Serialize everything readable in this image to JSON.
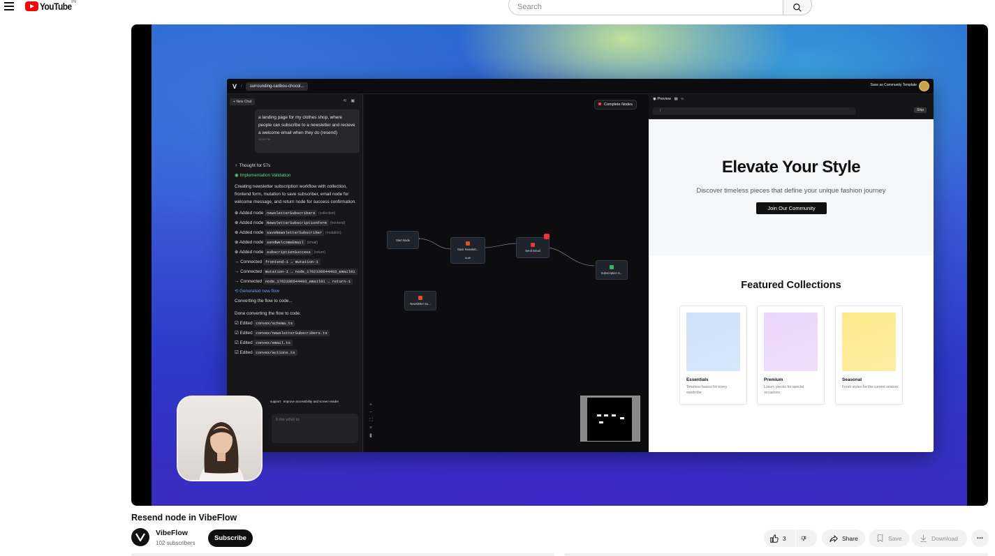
{
  "header": {
    "logo_text": "YouTube",
    "country_code": "IN",
    "search_placeholder": "Search"
  },
  "video": {
    "app": {
      "logo": "V",
      "project_name": "surrounding-caribou-chocol...",
      "save_template_label": "Save as Community Template",
      "new_chat_label": "New Chat",
      "prompt_text": "a landing page for my clothes shop, where people can subscribe to a newsletter and recieve a welcome email when they do (resend)",
      "prompt_time": "03:58 PM",
      "thought": "Thought for 57s",
      "validation": "Implementation Validation",
      "summary": "Creating newsletter subscription workflow with collection, frontend form, mutation to save subscriber, email node for welcome message, and return node for success confirmation.",
      "log_rows": [
        {
          "action": "Added node",
          "code": "newsletterSubscribers",
          "tag": "(collection)"
        },
        {
          "action": "Added node",
          "code": "NewsletterSubscriptionForm",
          "tag": "(frontend)"
        },
        {
          "action": "Added node",
          "code": "saveNewsletterSubscriber",
          "tag": "(mutation)"
        },
        {
          "action": "Added node",
          "code": "sendWelcomeEmail",
          "tag": "(email)"
        },
        {
          "action": "Added node",
          "code": "subscriptionSuccess",
          "tag": "(return)"
        },
        {
          "action": "Connected",
          "code": "frontend-1 → mutation-1",
          "tag": ""
        },
        {
          "action": "Connected",
          "code": "mutation-1 → node_1762336644403_email01",
          "tag": ""
        },
        {
          "action": "Connected",
          "code": "node_1762336644403_email01 → return-1",
          "tag": ""
        }
      ],
      "generated": "Generated new flow",
      "converting": "Converting the flow to code...",
      "done": "Done converting the flow to code.",
      "edited_files": [
        "convex/schema.ts",
        "convex/newsletterSubscribers.ts",
        "convex/email.ts",
        "convex/actions.ts"
      ],
      "edited_label": "Edited",
      "suggestion_1": "support",
      "suggestion_2": "Improve accessibility and screen reader",
      "input_placeholder": "ll me what to",
      "complete_nodes": "Complete Nodes",
      "nodes": {
        "start": "Start Node",
        "save": "Save Newslett...",
        "auth": "Auth",
        "email": "Send Email",
        "subscription": "Subscription S...",
        "newsletter": "Newsletter Su..."
      },
      "preview_tab": "Preview",
      "preview_url": "/",
      "ship_label": "Ship",
      "site": {
        "hero_title": "Elevate Your Style",
        "hero_subtitle": "Discover timeless pieces that define your unique fashion journey",
        "hero_button": "Join Our Community",
        "featured_title": "Featured Collections",
        "cards": [
          {
            "name": "Essentials",
            "desc": "Timeless basics for every wardrobe",
            "color": "#cfe0fb"
          },
          {
            "name": "Premium",
            "desc": "Luxury pieces for special occasions",
            "color": "#ead6fa"
          },
          {
            "name": "Seasonal",
            "desc": "Fresh styles for the current season",
            "color": "#fde98c"
          }
        ]
      }
    }
  },
  "meta": {
    "title": "Resend node in VibeFlow",
    "channel_name": "VibeFlow",
    "subscribers": "102 subscribers",
    "subscribe_label": "Subscribe",
    "like_count": "3",
    "share_label": "Share",
    "save_label": "Save",
    "download_label": "Download",
    "more_label": "..."
  },
  "colors": {
    "brand_red": "#ff0000",
    "subscribe_bg": "#0f0f0f",
    "pill_bg": "#f2f2f2"
  }
}
